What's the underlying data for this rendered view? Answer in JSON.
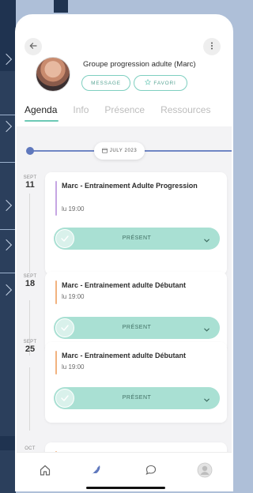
{
  "header": {
    "group_title": "Groupe progression adulte (Marc)",
    "message_label": "MESSAGE",
    "favori_label": "FAVORI"
  },
  "tabs": [
    {
      "label": "Agenda",
      "active": true
    },
    {
      "label": "Info",
      "active": false
    },
    {
      "label": "Présence",
      "active": false
    },
    {
      "label": "Ressources",
      "active": false
    }
  ],
  "timeline": {
    "month_label": "JULY 2023"
  },
  "events": [
    {
      "month": "SEPT",
      "day": "11",
      "title": "Marc - Entrainement Adulte Progression",
      "time": "lu 19:00",
      "status": "PRÉSENT",
      "accent": "#c6a6e3"
    },
    {
      "month": "SEPT",
      "day": "18",
      "title": "Marc - Entrainement adulte Débutant",
      "time": "lu 19:00",
      "status": "PRÉSENT",
      "accent": "#f2b27f"
    },
    {
      "month": "SEPT",
      "day": "25",
      "title": "Marc - Entrainement adulte Débutant",
      "time": "lu 19:00",
      "status": "PRÉSENT",
      "accent": "#f2b27f"
    },
    {
      "month": "OCT",
      "day": "",
      "title": "",
      "time": "",
      "status": "",
      "accent": "#f2b27f"
    }
  ],
  "colors": {
    "accent": "#6cc9b6",
    "present_pill": "#a9e0d3",
    "timeline": "#6f86c4"
  },
  "icons": {
    "back": "arrow-left-icon",
    "more": "more-vertical-icon",
    "favori": "star-icon",
    "calendar": "calendar-icon",
    "check": "check-icon",
    "chevron": "chevron-down-icon",
    "nav": [
      "home-icon",
      "feather-icon",
      "chat-icon",
      "profile-icon"
    ]
  }
}
